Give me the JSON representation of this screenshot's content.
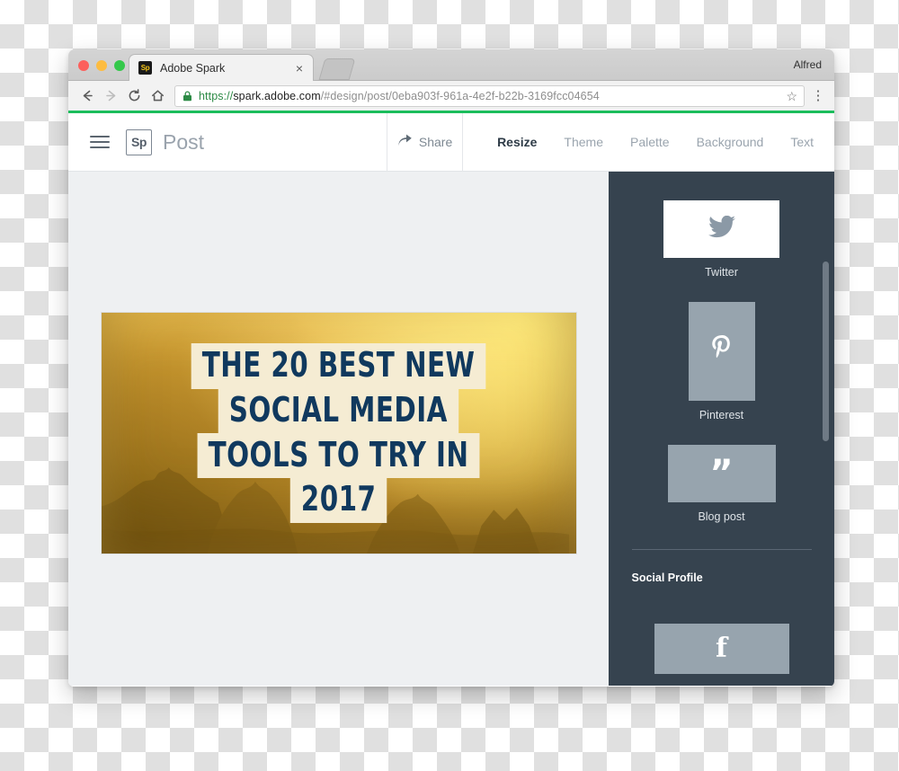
{
  "browser": {
    "profile_name": "Alfred",
    "tab": {
      "title": "Adobe Spark",
      "favicon_text": "Sp",
      "close_label": "×",
      "favicon_icon": "adobe-spark-favicon"
    },
    "nav": {
      "back_icon": "arrow-left-icon",
      "forward_icon": "arrow-right-icon",
      "reload_icon": "reload-icon",
      "home_icon": "home-icon",
      "lock_icon": "padlock-icon",
      "bookmark_icon": "star-icon",
      "menu_icon": "kebab-menu-icon"
    },
    "url": {
      "scheme": "https://",
      "host": "spark.adobe.com",
      "path": "/#design/post/0eba903f-961a-4e2f-b22b-3169fcc04654",
      "full": "https://spark.adobe.com/#design/post/0eba903f-961a-4e2f-b22b-3169fcc04654"
    },
    "accent_color": "#1bbd5c"
  },
  "app": {
    "menu_icon": "hamburger-menu-icon",
    "logo_text": "Sp",
    "title": "Post",
    "share_label": "Share",
    "share_icon": "share-arrow-icon",
    "tabs": [
      {
        "label": "Resize",
        "active": true
      },
      {
        "label": "Theme",
        "active": false
      },
      {
        "label": "Palette",
        "active": false
      },
      {
        "label": "Background",
        "active": false
      },
      {
        "label": "Text",
        "active": false
      }
    ]
  },
  "poster": {
    "lines": [
      "THE 20 BEST NEW",
      "SOCIAL MEDIA",
      "TOOLS TO TRY IN",
      "2017"
    ],
    "text_color": "#10395e",
    "highlight_color": "#f5ecd3",
    "background_colors": [
      "#fce263",
      "#daa237",
      "#9c7520"
    ]
  },
  "panel": {
    "background_color": "#36434f",
    "cards": [
      {
        "label": "Twitter",
        "icon": "twitter-bird-icon",
        "selected": true
      },
      {
        "label": "Pinterest",
        "icon": "pinterest-p-icon",
        "selected": false
      },
      {
        "label": "Blog post",
        "icon": "quotation-mark-icon",
        "selected": false
      }
    ],
    "section_title": "Social Profile",
    "social_cards": [
      {
        "label": "Facebook",
        "icon": "facebook-f-icon",
        "glyph": "f"
      }
    ],
    "blog_glyph": "”",
    "scrollbar_name": "panel-scrollbar"
  }
}
